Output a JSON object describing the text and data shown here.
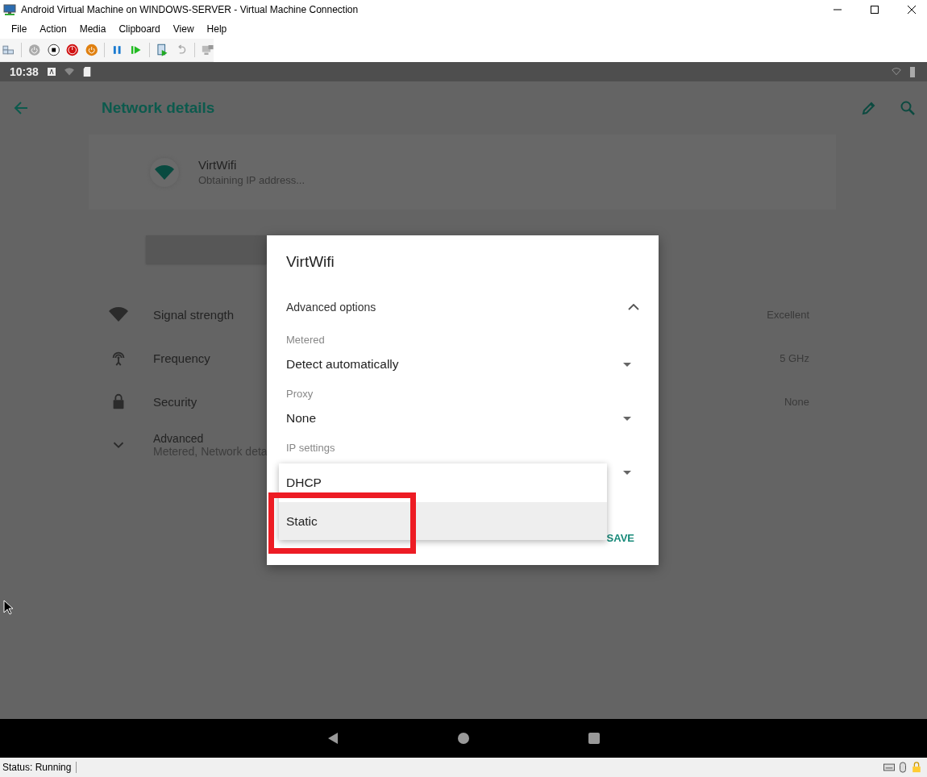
{
  "window": {
    "title": "Android Virtual Machine on WINDOWS-SERVER - Virtual Machine Connection"
  },
  "menu": [
    {
      "label": "File"
    },
    {
      "label": "Action"
    },
    {
      "label": "Media"
    },
    {
      "label": "Clipboard"
    },
    {
      "label": "View"
    },
    {
      "label": "Help"
    }
  ],
  "android_status_bar": {
    "time": "10:38"
  },
  "app_bar": {
    "title": "Network details"
  },
  "network": {
    "name": "VirtWifi",
    "status": "Obtaining IP address..."
  },
  "details": [
    {
      "kind": "signal",
      "label": "Signal strength",
      "value": "Excellent"
    },
    {
      "kind": "frequency",
      "label": "Frequency",
      "value": "5 GHz"
    },
    {
      "kind": "security",
      "label": "Security",
      "value": "None"
    }
  ],
  "advanced": {
    "label": "Advanced",
    "summary": "Metered, Network deta",
    "expanded": false
  },
  "dialog": {
    "title": "VirtWifi",
    "section": "Advanced options",
    "expanded": true,
    "fields": [
      {
        "label": "Metered",
        "value": "Detect automatically"
      },
      {
        "label": "Proxy",
        "value": "None"
      },
      {
        "label": "IP settings"
      }
    ],
    "dropdown": [
      {
        "label": "DHCP",
        "selected": false
      },
      {
        "label": "Static",
        "selected": true
      }
    ],
    "buttons": [
      "SAVE"
    ]
  },
  "status_bar": {
    "status": "Status: Running"
  }
}
